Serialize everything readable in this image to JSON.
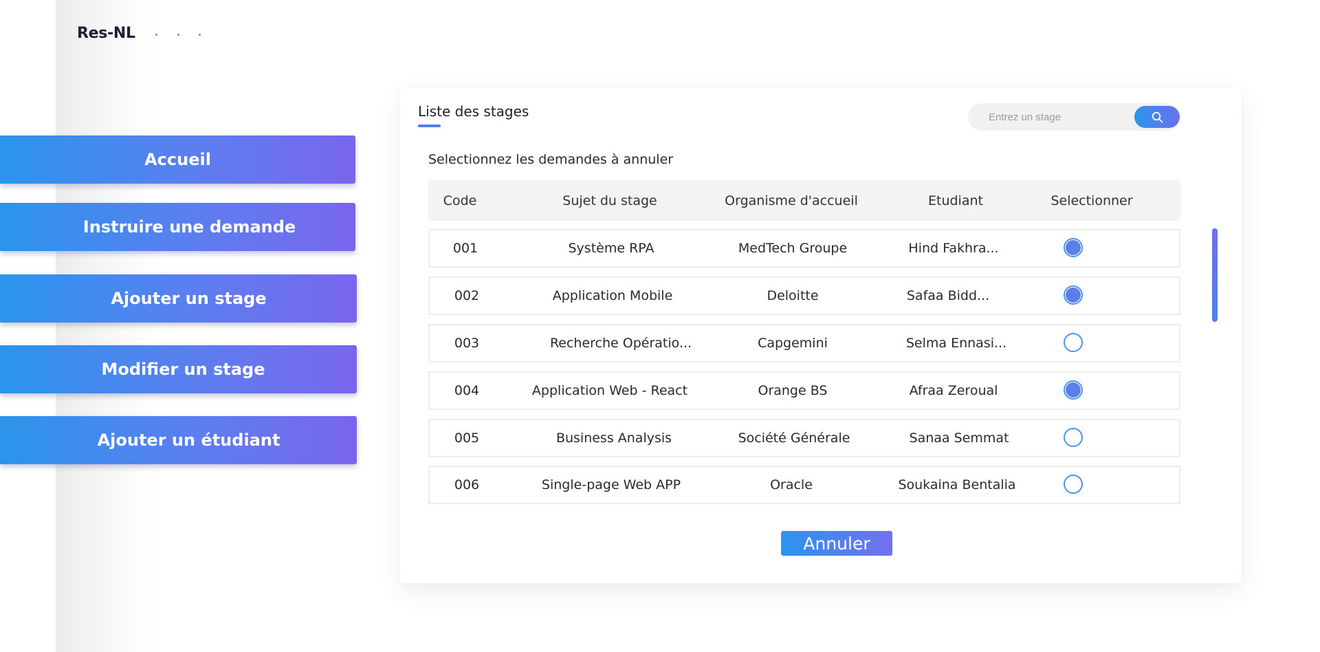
{
  "app": {
    "brand": "Res-NL"
  },
  "sidebar": {
    "items": [
      {
        "label": "Accueil"
      },
      {
        "label": "Instruire une demande"
      },
      {
        "label": "Ajouter un stage"
      },
      {
        "label": "Modifier un stage"
      },
      {
        "label": "Ajouter un étudiant"
      }
    ]
  },
  "main": {
    "title": "Liste des stages",
    "search": {
      "placeholder": "Entrez un stage",
      "value": "",
      "button_icon": "search-icon"
    },
    "instruction": "Selectionnez les demandes à annuler",
    "table": {
      "headers": {
        "code": "Code",
        "subject": "Sujet du stage",
        "organization": "Organisme d'accueil",
        "student": "Etudiant",
        "select": "Selectionner"
      },
      "rows": [
        {
          "code": "001",
          "subject": "Système RPA",
          "organization": "MedTech Groupe",
          "student": "Hind Fakhra...",
          "selected": true
        },
        {
          "code": "002",
          "subject": "Application Mobile",
          "organization": "Deloitte",
          "student": "Safaa Bidd...",
          "selected": true
        },
        {
          "code": "003",
          "subject": "Recherche Opératio...",
          "organization": "Capgemini",
          "student": "Selma Ennasi...",
          "selected": false
        },
        {
          "code": "004",
          "subject": "Application Web - React",
          "organization": "Orange BS",
          "student": "Afraa Zeroual",
          "selected": true
        },
        {
          "code": "005",
          "subject": "Business Analysis",
          "organization": "Société Générale",
          "student": "Sanaa Semmat",
          "selected": false
        },
        {
          "code": "006",
          "subject": "Single-page Web APP",
          "organization": "Oracle",
          "student": "Soukaina Bentalia",
          "selected": false
        }
      ]
    },
    "cancel_button": "Annuler"
  },
  "colors": {
    "accent_start": "#2b95ec",
    "accent_end": "#7966ee",
    "radio_fill": "#5b7fe7",
    "radio_border": "#4b96e6"
  }
}
